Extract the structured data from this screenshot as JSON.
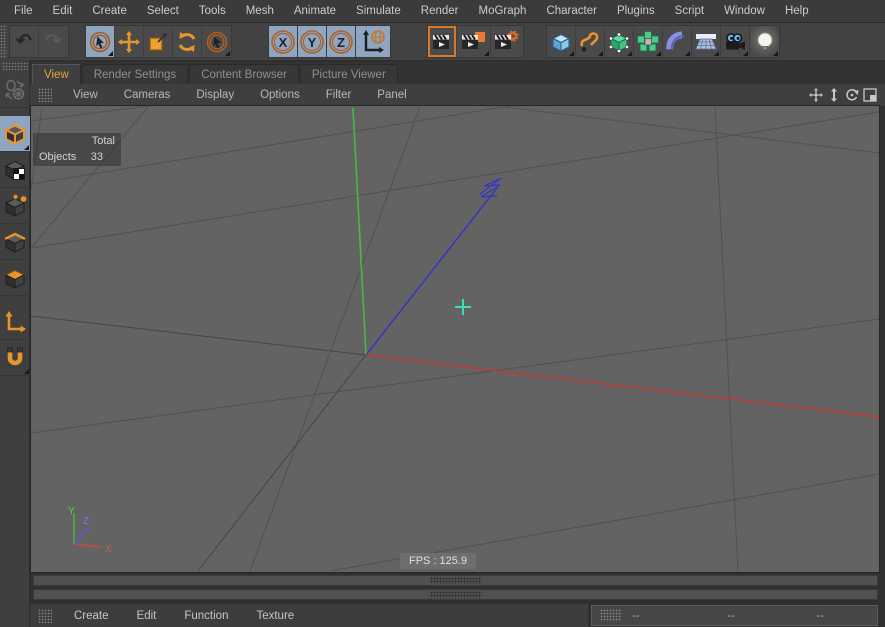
{
  "menubar": {
    "items": [
      "File",
      "Edit",
      "Create",
      "Select",
      "Tools",
      "Mesh",
      "Animate",
      "Simulate",
      "Render",
      "MoGraph",
      "Character",
      "Plugins",
      "Script",
      "Window",
      "Help"
    ]
  },
  "toolbar": {
    "undo_glyph": "↶",
    "redo_glyph": "↷",
    "axis_x": "X",
    "axis_y": "Y",
    "axis_z": "Z",
    "icons": [
      "undo",
      "redo",
      "live-selection",
      "move",
      "scale",
      "rotate",
      "selection",
      "lock-x-axis",
      "lock-y-axis",
      "lock-z-axis",
      "coordinate-system",
      "render-view",
      "render-to-picture-viewer",
      "edit-render-settings",
      "add-cube",
      "add-spline",
      "add-subdivision-surface",
      "add-array",
      "add-deformer",
      "add-floor",
      "add-camera",
      "add-light"
    ]
  },
  "sidebar": {
    "icons": [
      "convert-to-editable",
      "model-mode",
      "texture-mode",
      "point-mode",
      "edge-mode",
      "polygon-mode",
      "enable-axis-modification",
      "enable-snap"
    ]
  },
  "tabs": {
    "items": [
      {
        "label": "View",
        "active": true
      },
      {
        "label": "Render Settings",
        "active": false
      },
      {
        "label": "Content Browser",
        "active": false
      },
      {
        "label": "Picture Viewer",
        "active": false
      }
    ]
  },
  "viewport_menu": {
    "items": [
      "View",
      "Cameras",
      "Display",
      "Options",
      "Filter",
      "Panel"
    ],
    "camera_icons": [
      "pan-camera-icon",
      "zoom-camera-icon",
      "rotate-camera-icon",
      "toggle-view-icon"
    ]
  },
  "viewport": {
    "hud": {
      "total_label": "Total",
      "objects_label": "Objects",
      "objects_value": "33"
    },
    "fps_label": "FPS : 125.9",
    "axis_gizmo": {
      "x": "X",
      "y": "Y",
      "z": "Z"
    }
  },
  "bottom_menu": {
    "items": [
      "Create",
      "Edit",
      "Function",
      "Texture"
    ]
  },
  "status_bar": {
    "fields": [
      "--",
      "--",
      "--"
    ]
  },
  "colors": {
    "accent_orange": "#e8952c",
    "selection_blue": "#8ea6c2",
    "active_tab_text": "#e8a33d",
    "viewport_bg": "#636363",
    "grid_line": "#515151",
    "axis_x_red": "#c23a2e",
    "axis_y_green": "#44bb44",
    "axis_z_blue": "#3333cc",
    "cursor_cyan": "#3be0b8"
  }
}
